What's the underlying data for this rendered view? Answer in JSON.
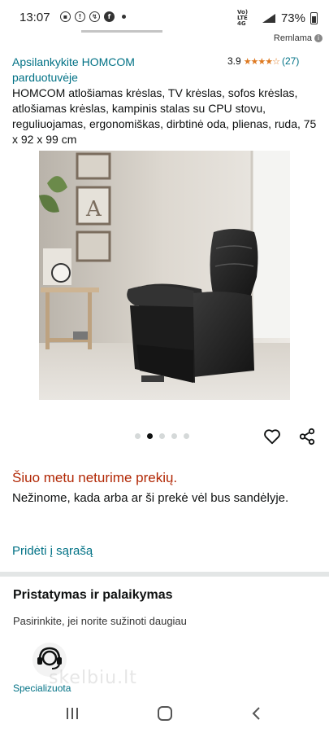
{
  "status_bar": {
    "time": "13:07",
    "network": "Vo) LTE 4G",
    "battery_pct": "73%"
  },
  "ad": {
    "label": "Remlama",
    "info_icon": "info-icon"
  },
  "product": {
    "store_link": "Apsilankykite HOMCOM parduotuvėje",
    "rating_value": "3.9",
    "rating_stars": "★★★★☆",
    "rating_count": "(27)",
    "title": "HOMCOM atlošiamas krėslas, TV krėslas, sofos krėslas, atlošiamas krėslas, kampinis stalas su CPU stovu, reguliuojamas, ergonomiškas, dirbtinė oda, plienas, ruda, 75 x 92 x 99 cm",
    "image_count": 5,
    "active_image": 1
  },
  "availability": {
    "status": "Šiuo metu neturime prekių.",
    "detail": "Nežinome, kada arba ar ši prekė vėl bus sandėlyje.",
    "add_to_list": "Pridėti į sąrašą"
  },
  "delivery": {
    "title": "Pristatymas ir palaikymas",
    "subtitle": "Pasirinkite, jei norite sužinoti daugiau",
    "support_label": "Specializuota"
  },
  "watermark": "skelbiu.lt",
  "colors": {
    "link": "#007185",
    "alert": "#b12704",
    "star": "#de7921",
    "separator": "#e3e6e6"
  }
}
